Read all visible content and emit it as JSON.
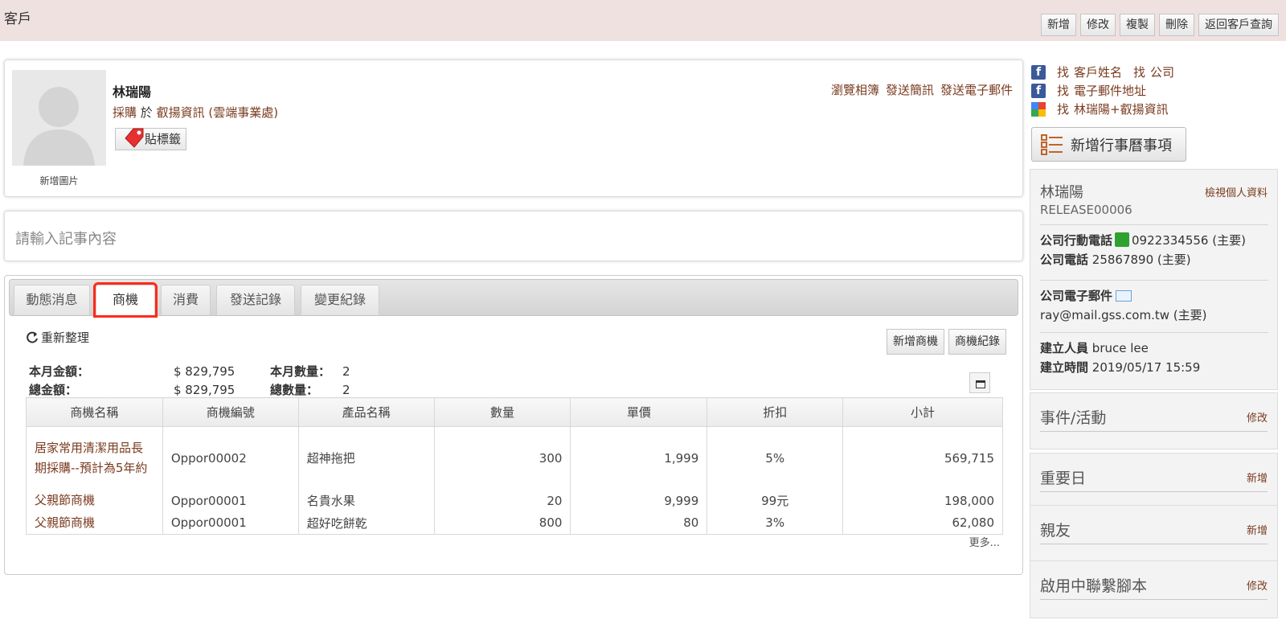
{
  "header": {
    "title": "客戶",
    "buttons": [
      "新增",
      "修改",
      "複製",
      "刪除",
      "返回客戶查詢"
    ]
  },
  "profile": {
    "avatar_caption": "新增圖片",
    "name": "林瑞陽",
    "job_role": "採購",
    "job_at": "於",
    "job_company": "叡揚資訊 (雲端事業處)",
    "tag_button": "貼標籤",
    "links": [
      "瀏覽相簿",
      "發送簡訊",
      "發送電子郵件"
    ]
  },
  "note": {
    "placeholder": "請輸入記事內容"
  },
  "tabs": [
    "動態消息",
    "商機",
    "消費",
    "發送記錄",
    "變更紀錄"
  ],
  "opportunity": {
    "reorganize": "重新整理",
    "buttons": [
      "新增商機",
      "商機紀錄"
    ],
    "summary": {
      "month_amount_label": "本月金額：",
      "month_amount": "$ 829,795",
      "month_count_label": "本月數量：",
      "month_count": "2",
      "total_amount_label": "總金額：",
      "total_amount": "$ 829,795",
      "total_count_label": "總數量：",
      "total_count": "2"
    },
    "columns": [
      "商機名稱",
      "商機編號",
      "產品名稱",
      "數量",
      "單價",
      "折扣",
      "小計"
    ],
    "rows": [
      [
        "居家常用清潔用品長期採購--預計為5年約",
        "Oppor00002",
        "超神拖把",
        "300",
        "1,999",
        "5%",
        "569,715"
      ],
      [
        "父親節商機",
        "Oppor00001",
        "名貴水果",
        "20",
        "9,999",
        "99元",
        "198,000"
      ],
      [
        "父親節商機",
        "Oppor00001",
        "超好吃餅乾",
        "800",
        "80",
        "3%",
        "62,080"
      ]
    ],
    "more": "更多..."
  },
  "right": {
    "find_links": [
      {
        "prefix": "找",
        "a": "客戶姓名",
        "prefix2": "找",
        "b": "公司"
      },
      {
        "prefix": "找",
        "a": "電子郵件地址"
      },
      {
        "prefix": "找",
        "a": "林瑞陽+叡揚資訊"
      }
    ],
    "calendar_button": "新增行事曆事項",
    "info": {
      "name": "林瑞陽",
      "view_profile": "檢視個人資料",
      "code": "RELEASE00006",
      "mobile_label": "公司行動電話",
      "mobile": "0922334556 (主要)",
      "phone_label": "公司電話",
      "phone": "25867890 (主要)",
      "email_label": "公司電子郵件",
      "email": "ray@mail.gss.com.tw (主要)",
      "creator_label": "建立人員",
      "creator": "bruce lee",
      "created_label": "建立時間",
      "created": "2019/05/17 15:59"
    },
    "boxes": [
      {
        "title": "事件/活動",
        "action": "修改"
      },
      {
        "title": "重要日",
        "action": "新增"
      },
      {
        "title": "親友",
        "action": "新增"
      },
      {
        "title": "啟用中聯繫腳本",
        "action": "修改"
      }
    ]
  },
  "colors": {
    "link": "#7a3b1f",
    "topbar": "#f0e1e1",
    "highlight": "#ff2a1a",
    "facebook": "#3b5998"
  }
}
